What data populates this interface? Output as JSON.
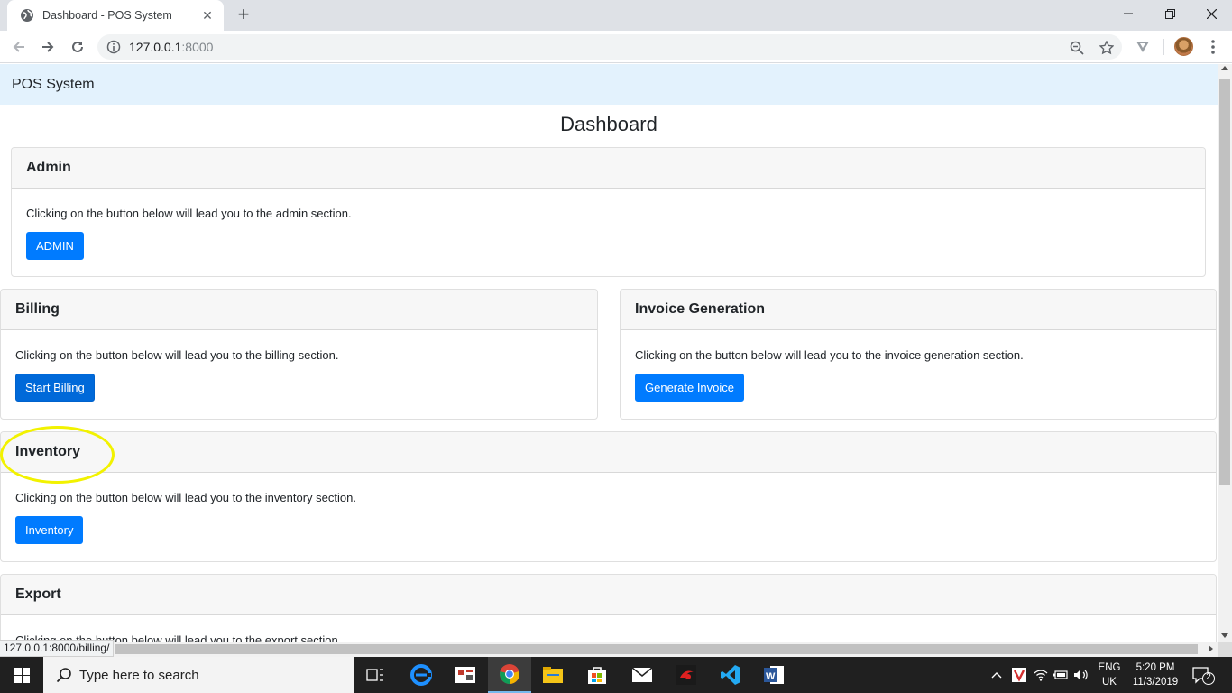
{
  "browser": {
    "tab_title": "Dashboard - POS System",
    "url_host": "127.0.0.1",
    "url_port": ":8000",
    "status_url": "127.0.0.1:8000/billing/"
  },
  "page": {
    "brand": "POS System",
    "title": "Dashboard"
  },
  "cards": {
    "admin": {
      "header": "Admin",
      "text": "Clicking on the button below will lead you to the admin section.",
      "button": "ADMIN"
    },
    "billing": {
      "header": "Billing",
      "text": "Clicking on the button below will lead you to the billing section.",
      "button": "Start Billing"
    },
    "invoice": {
      "header": "Invoice Generation",
      "text": "Clicking on the button below will lead you to the invoice generation section.",
      "button": "Generate Invoice"
    },
    "inventory": {
      "header": "Inventory",
      "text": "Clicking on the button below will lead you to the inventory section.",
      "button": "Inventory"
    },
    "export": {
      "header": "Export",
      "text": "Clicking on the button below will lead you to the export section."
    }
  },
  "colors": {
    "primary": "#007bff",
    "navbar_bg": "#e3f2fd",
    "highlight": "#f2f200"
  },
  "taskbar": {
    "search_placeholder": "Type here to search",
    "lang_line1": "ENG",
    "lang_line2": "UK",
    "time": "5:20 PM",
    "date": "11/3/2019",
    "notification_count": "2",
    "apps": [
      "task-view-icon",
      "edge-icon",
      "app-icon",
      "chrome-icon",
      "file-explorer-icon",
      "store-icon",
      "mail-icon",
      "game-icon",
      "vscode-icon",
      "word-icon"
    ]
  }
}
